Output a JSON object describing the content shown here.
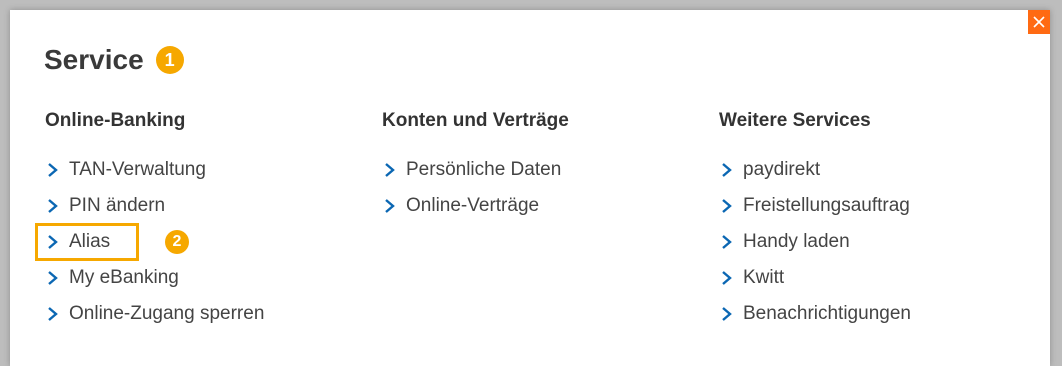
{
  "header": {
    "title": "Service",
    "badge_1": "1",
    "badge_2": "2"
  },
  "colors": {
    "accent_orange": "#f6a800",
    "close_orange": "#ff6a13",
    "link_blue": "#0b67b3"
  },
  "columns": [
    {
      "heading": "Online-Banking",
      "items": [
        "TAN-Verwaltung",
        "PIN ändern",
        "Alias",
        "My eBanking",
        "Online-Zugang sperren"
      ]
    },
    {
      "heading": "Konten und Verträge",
      "items": [
        "Persönliche Daten",
        "Online-Verträge"
      ]
    },
    {
      "heading": "Weitere Services",
      "items": [
        "paydirekt",
        "Freistellungsauftrag",
        "Handy laden",
        "Kwitt",
        "Benachrichtigungen"
      ]
    }
  ],
  "icons": {
    "close": "close-icon",
    "link": "chevron-right-icon"
  }
}
